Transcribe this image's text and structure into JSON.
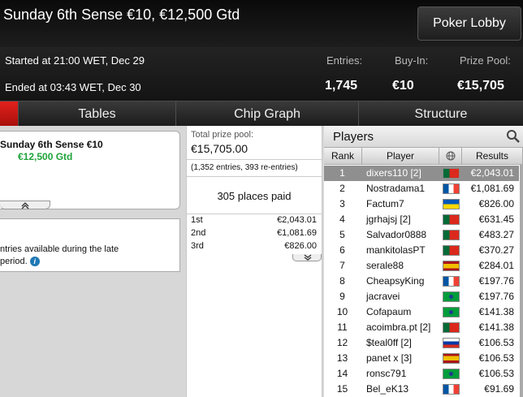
{
  "header": {
    "title": "Sunday 6th Sense €10, €12,500 Gtd",
    "lobby_button": "Poker Lobby"
  },
  "info": {
    "started": "Started at 21:00 WET, Dec 29",
    "ended": "Ended at 03:43 WET, Dec 30",
    "entries_label": "Entries:",
    "entries_value": "1,745",
    "buyin_label": "Buy-In:",
    "buyin_value": "€10",
    "prize_label": "Prize Pool:",
    "prize_value": "€15,705"
  },
  "tabs": [
    "Tables",
    "Chip Graph",
    "Structure"
  ],
  "left": {
    "name": "Sunday 6th Sense €10",
    "guarantee": "€12,500 Gtd",
    "notice_line1": "ntries available during the late",
    "notice_line2": "period."
  },
  "prize": {
    "total_label": "Total prize pool:",
    "total_value": "€15,705.00",
    "entries_note": "(1,352 entries, 393 re-entries)",
    "places_paid": "305 places paid",
    "rows": [
      {
        "place": "1st",
        "amount": "€2,043.01"
      },
      {
        "place": "2nd",
        "amount": "€1,081.69"
      },
      {
        "place": "3rd",
        "amount": "€826.00"
      }
    ]
  },
  "players": {
    "title": "Players",
    "headers": {
      "rank": "Rank",
      "player": "Player",
      "results": "Results"
    },
    "rows": [
      {
        "rank": "1",
        "name": "dixers110 [2]",
        "flag": "portugal",
        "result": "€2,043.01"
      },
      {
        "rank": "2",
        "name": "Nostradama1",
        "flag": "france",
        "result": "€1,081.69"
      },
      {
        "rank": "3",
        "name": "Factum7",
        "flag": "ukraine",
        "result": "€826.00"
      },
      {
        "rank": "4",
        "name": "jgrhajsj [2]",
        "flag": "portugal",
        "result": "€631.45"
      },
      {
        "rank": "5",
        "name": "Salvador0888",
        "flag": "portugal",
        "result": "€483.27"
      },
      {
        "rank": "6",
        "name": "mankitolasPT",
        "flag": "portugal",
        "result": "€370.27"
      },
      {
        "rank": "7",
        "name": "serale88",
        "flag": "spain",
        "result": "€284.01"
      },
      {
        "rank": "8",
        "name": "CheapsyKing",
        "flag": "france",
        "result": "€197.76"
      },
      {
        "rank": "9",
        "name": "jacravei",
        "flag": "brazil",
        "result": "€197.76"
      },
      {
        "rank": "10",
        "name": "Cofapaum",
        "flag": "brazil",
        "result": "€141.38"
      },
      {
        "rank": "11",
        "name": "acoimbra.pt [2]",
        "flag": "portugal",
        "result": "€141.38"
      },
      {
        "rank": "12",
        "name": "$teal0ff [2]",
        "flag": "russia",
        "result": "€106.53"
      },
      {
        "rank": "13",
        "name": "panet x [3]",
        "flag": "spain",
        "result": "€106.53"
      },
      {
        "rank": "14",
        "name": "ronsc791",
        "flag": "brazil",
        "result": "€106.53"
      },
      {
        "rank": "15",
        "name": "Bel_eK13",
        "flag": "france",
        "result": "€91.69"
      }
    ]
  },
  "colors": {
    "accent_red": "#d41a14",
    "guarantee_green": "#1fa33a",
    "selected_row": "#8f8f8f"
  }
}
